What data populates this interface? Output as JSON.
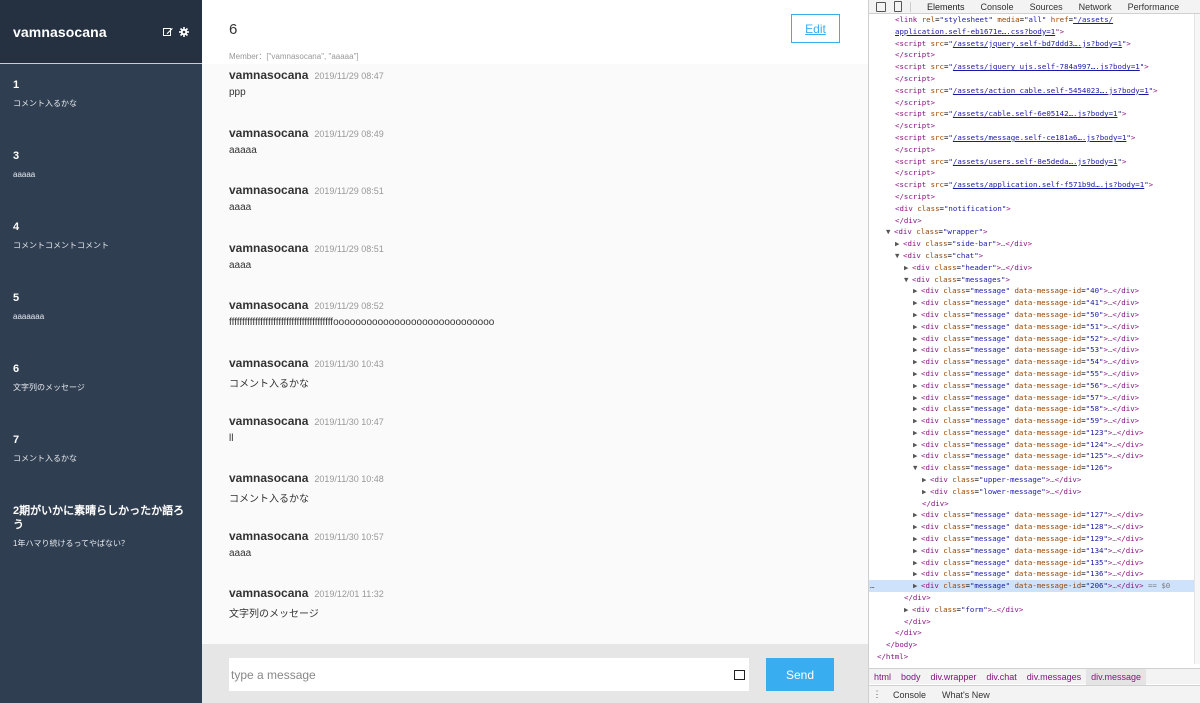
{
  "sidebar": {
    "user_name": "vamnasocana",
    "icons": [
      "edit-icon",
      "gear-icon"
    ],
    "groups": [
      {
        "name": "1",
        "last_message": "コメント入るかな"
      },
      {
        "name": "3",
        "last_message": "aaaaa"
      },
      {
        "name": "4",
        "last_message": "コメントコメントコメント"
      },
      {
        "name": "5",
        "last_message": "aaaaaaa"
      },
      {
        "name": "6",
        "last_message": "文字列のメッセージ"
      },
      {
        "name": "7",
        "last_message": "コメント入るかな"
      },
      {
        "name": "2期がいかに素晴らしかったか語ろう",
        "last_message": "1年ハマり続けるってやばない？"
      }
    ]
  },
  "chat": {
    "room_name": "6",
    "members": "Member：[\"vamnasocana\", \"aaaaa\"]",
    "edit_label": "Edit",
    "messages": [
      {
        "user": "vamnasocana",
        "date": "2019/11/29 08:47",
        "text": "ppp"
      },
      {
        "user": "vamnasocana",
        "date": "2019/11/29 08:49",
        "text": "aaaaa"
      },
      {
        "user": "vamnasocana",
        "date": "2019/11/29 08:51",
        "text": "aaaa"
      },
      {
        "user": "vamnasocana",
        "date": "2019/11/29 08:51",
        "text": "aaaa"
      },
      {
        "user": "vamnasocana",
        "date": "2019/11/29 08:52",
        "text": "ffffffffffffffffffffffffffffffffffffffffooooooooooooooooooooooooooooo"
      },
      {
        "user": "vamnasocana",
        "date": "2019/11/30 10:43",
        "text": "コメント入るかな"
      },
      {
        "user": "vamnasocana",
        "date": "2019/11/30 10:47",
        "text": "ll"
      },
      {
        "user": "vamnasocana",
        "date": "2019/11/30 10:48",
        "text": "コメント入るかな"
      },
      {
        "user": "vamnasocana",
        "date": "2019/11/30 10:57",
        "text": "aaaa"
      },
      {
        "user": "vamnasocana",
        "date": "2019/12/01 11:32",
        "text": "文字列のメッセージ"
      }
    ],
    "input_placeholder": "type a message",
    "send_label": "Send"
  },
  "devtools": {
    "tabs": [
      "Elements",
      "Console",
      "Sources",
      "Network",
      "Performance"
    ],
    "tree_lines": [
      {
        "indent": 3,
        "html": "<span class=\"tag\">&lt;link</span> <span class=\"attr\">rel</span>=<span class=\"val\">\"stylesheet\"</span> <span class=\"attr\">media</span>=<span class=\"val\">\"all\"</span> <span class=\"attr\">href</span>=<span class=\"link\">\"/assets/</span>"
      },
      {
        "indent": 3,
        "html": "<span class=\"link\">application.self-eb1671e….css?body=1</span><span class=\"tag\">\"&gt;</span>"
      },
      {
        "indent": 3,
        "html": "<span class=\"tag\">&lt;script</span> <span class=\"attr\">src</span>=<span class=\"val\">\"</span><span class=\"link\">/assets/jquery.self-bd7ddd3….js?body=1</span><span class=\"val\">\"</span><span class=\"tag\">&gt;</span>"
      },
      {
        "indent": 3,
        "html": "<span class=\"tag\">&lt;/script&gt;</span>"
      },
      {
        "indent": 3,
        "html": "<span class=\"tag\">&lt;script</span> <span class=\"attr\">src</span>=<span class=\"val\">\"</span><span class=\"link\">/assets/jquery_ujs.self-784a997….js?body=1</span><span class=\"val\">\"</span><span class=\"tag\">&gt;</span>"
      },
      {
        "indent": 3,
        "html": "<span class=\"tag\">&lt;/script&gt;</span>"
      },
      {
        "indent": 3,
        "html": "<span class=\"tag\">&lt;script</span> <span class=\"attr\">src</span>=<span class=\"val\">\"</span><span class=\"link\">/assets/action_cable.self-5454023….js?body=1</span><span class=\"val\">\"</span><span class=\"tag\">&gt;</span>"
      },
      {
        "indent": 3,
        "html": "<span class=\"tag\">&lt;/script&gt;</span>"
      },
      {
        "indent": 3,
        "html": "<span class=\"tag\">&lt;script</span> <span class=\"attr\">src</span>=<span class=\"val\">\"</span><span class=\"link\">/assets/cable.self-6e05142….js?body=1</span><span class=\"val\">\"</span><span class=\"tag\">&gt;</span>"
      },
      {
        "indent": 3,
        "html": "<span class=\"tag\">&lt;/script&gt;</span>"
      },
      {
        "indent": 3,
        "html": "<span class=\"tag\">&lt;script</span> <span class=\"attr\">src</span>=<span class=\"val\">\"</span><span class=\"link\">/assets/message.self-ce181a6….js?body=1</span><span class=\"val\">\"</span><span class=\"tag\">&gt;</span>"
      },
      {
        "indent": 3,
        "html": "<span class=\"tag\">&lt;/script&gt;</span>"
      },
      {
        "indent": 3,
        "html": "<span class=\"tag\">&lt;script</span> <span class=\"attr\">src</span>=<span class=\"val\">\"</span><span class=\"link\">/assets/users.self-8e5deda….js?body=1</span><span class=\"val\">\"</span><span class=\"tag\">&gt;</span>"
      },
      {
        "indent": 3,
        "html": "<span class=\"tag\">&lt;/script&gt;</span>"
      },
      {
        "indent": 3,
        "html": "<span class=\"tag\">&lt;script</span> <span class=\"attr\">src</span>=<span class=\"val\">\"</span><span class=\"link\">/assets/application.self-f571b9d….js?body=1</span><span class=\"val\">\"</span><span class=\"tag\">&gt;</span>"
      },
      {
        "indent": 3,
        "html": "<span class=\"tag\">&lt;/script&gt;</span>"
      },
      {
        "indent": 3,
        "html": "<span class=\"tag\">&lt;div</span> <span class=\"attr\">class</span>=<span class=\"val\">\"notification\"</span><span class=\"tag\">&gt;</span>"
      },
      {
        "indent": 3,
        "html": "<span class=\"tag\">&lt;/div&gt;</span>"
      },
      {
        "indent": 2,
        "html": "<span class=\"tri\">▼</span><span class=\"tag\">&lt;div</span> <span class=\"attr\">class</span>=<span class=\"val\">\"wrapper\"</span><span class=\"tag\">&gt;</span>"
      },
      {
        "indent": 3,
        "html": "<span class=\"tri\">▶</span><span class=\"tag\">&lt;div</span> <span class=\"attr\">class</span>=<span class=\"val\">\"side-bar\"</span><span class=\"tag\">&gt;</span><span class=\"ell\">…</span><span class=\"tag\">&lt;/div&gt;</span>"
      },
      {
        "indent": 3,
        "html": "<span class=\"tri\">▼</span><span class=\"tag\">&lt;div</span> <span class=\"attr\">class</span>=<span class=\"val\">\"chat\"</span><span class=\"tag\">&gt;</span>"
      },
      {
        "indent": 4,
        "html": "<span class=\"tri\">▶</span><span class=\"tag\">&lt;div</span> <span class=\"attr\">class</span>=<span class=\"val\">\"header\"</span><span class=\"tag\">&gt;</span><span class=\"ell\">…</span><span class=\"tag\">&lt;/div&gt;</span>"
      },
      {
        "indent": 4,
        "html": "<span class=\"tri\">▼</span><span class=\"tag\">&lt;div</span> <span class=\"attr\">class</span>=<span class=\"val\">\"messages\"</span><span class=\"tag\">&gt;</span>"
      },
      {
        "indent": 5,
        "msg": "40"
      },
      {
        "indent": 5,
        "msg": "41"
      },
      {
        "indent": 5,
        "msg": "50"
      },
      {
        "indent": 5,
        "msg": "51"
      },
      {
        "indent": 5,
        "msg": "52"
      },
      {
        "indent": 5,
        "msg": "53"
      },
      {
        "indent": 5,
        "msg": "54"
      },
      {
        "indent": 5,
        "msg": "55"
      },
      {
        "indent": 5,
        "msg": "56"
      },
      {
        "indent": 5,
        "msg": "57"
      },
      {
        "indent": 5,
        "msg": "58"
      },
      {
        "indent": 5,
        "msg": "59"
      },
      {
        "indent": 5,
        "msg": "123"
      },
      {
        "indent": 5,
        "msg": "124"
      },
      {
        "indent": 5,
        "msg": "125"
      },
      {
        "indent": 5,
        "html": "<span class=\"tri\">▼</span><span class=\"tag\">&lt;div</span> <span class=\"attr\">class</span>=<span class=\"val\">\"message\"</span> <span class=\"attr\">data-message-id</span>=<span class=\"val\">\"126\"</span><span class=\"tag\">&gt;</span>"
      },
      {
        "indent": 6,
        "html": "<span class=\"tri\">▶</span><span class=\"tag\">&lt;div</span> <span class=\"attr\">class</span>=<span class=\"val\">\"upper-message\"</span><span class=\"tag\">&gt;</span><span class=\"ell\">…</span><span class=\"tag\">&lt;/div&gt;</span>"
      },
      {
        "indent": 6,
        "html": "<span class=\"tri\">▶</span><span class=\"tag\">&lt;div</span> <span class=\"attr\">class</span>=<span class=\"val\">\"lower-message\"</span><span class=\"tag\">&gt;</span><span class=\"ell\">…</span><span class=\"tag\">&lt;/div&gt;</span>"
      },
      {
        "indent": 6,
        "html": "<span class=\"tag\">&lt;/div&gt;</span>"
      },
      {
        "indent": 5,
        "msg": "127"
      },
      {
        "indent": 5,
        "msg": "128"
      },
      {
        "indent": 5,
        "msg": "129"
      },
      {
        "indent": 5,
        "msg": "134"
      },
      {
        "indent": 5,
        "msg": "135"
      },
      {
        "indent": 5,
        "msg": "136"
      },
      {
        "indent": 5,
        "msg": "206",
        "hl": true
      },
      {
        "indent": 4,
        "html": "<span class=\"tag\">&lt;/div&gt;</span>"
      },
      {
        "indent": 4,
        "html": "<span class=\"tri\">▶</span><span class=\"tag\">&lt;div</span> <span class=\"attr\">class</span>=<span class=\"val\">\"form\"</span><span class=\"tag\">&gt;</span><span class=\"ell\">…</span><span class=\"tag\">&lt;/div&gt;</span>"
      },
      {
        "indent": 4,
        "html": "<span class=\"tag\">&lt;/div&gt;</span>"
      },
      {
        "indent": 3,
        "html": "<span class=\"tag\">&lt;/div&gt;</span>"
      },
      {
        "indent": 2,
        "html": "<span class=\"tag\">&lt;/body&gt;</span>"
      },
      {
        "indent": 1,
        "html": "<span class=\"tag\">&lt;/html&gt;</span>"
      }
    ],
    "breadcrumbs": [
      "html",
      "body",
      "div.wrapper",
      "div.chat",
      "div.messages",
      "div.message"
    ],
    "drawer_tabs": [
      "Console",
      "What's New"
    ],
    "highlight_suffix": " == $0"
  }
}
